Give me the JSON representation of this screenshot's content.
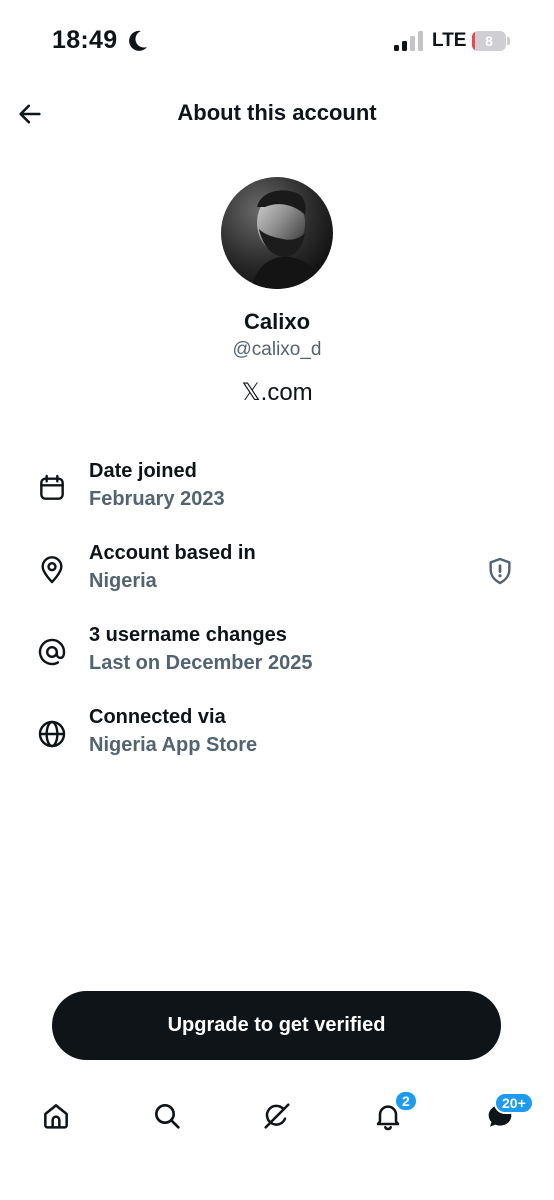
{
  "status_bar": {
    "time": "18:49",
    "network": "LTE",
    "battery_level": "8",
    "battery_color": "#e5484d",
    "battery_fraction": 0.08,
    "signal_bars": 2,
    "focus_icon": "moon-icon"
  },
  "header": {
    "title": "About this account",
    "back_icon": "arrow-left-icon"
  },
  "profile": {
    "display_name": "Calixo",
    "handle": "@calixo_d",
    "platform": "𝕏.com"
  },
  "info_rows": [
    {
      "icon": "calendar-icon",
      "title": "Date joined",
      "subtitle": "February 2023"
    },
    {
      "icon": "location-pin-icon",
      "title": "Account based in",
      "subtitle": "Nigeria",
      "trailing_icon": "shield-alert-icon"
    },
    {
      "icon": "at-sign-icon",
      "title": "3 username changes",
      "subtitle": "Last on December 2025"
    },
    {
      "icon": "globe-icon",
      "title": "Connected via",
      "subtitle": "Nigeria App Store"
    }
  ],
  "upgrade_button": {
    "label": "Upgrade to get verified"
  },
  "bottom_nav": {
    "items": [
      {
        "icon": "home-icon"
      },
      {
        "icon": "search-icon"
      },
      {
        "icon": "grok-icon"
      },
      {
        "icon": "bell-icon",
        "badge": "2"
      },
      {
        "icon": "messages-icon",
        "badge": "20+"
      }
    ]
  },
  "colors": {
    "text_primary": "#0f1419",
    "text_secondary": "#536471",
    "accent": "#1d9bf0",
    "button_bg": "#0f1419"
  }
}
